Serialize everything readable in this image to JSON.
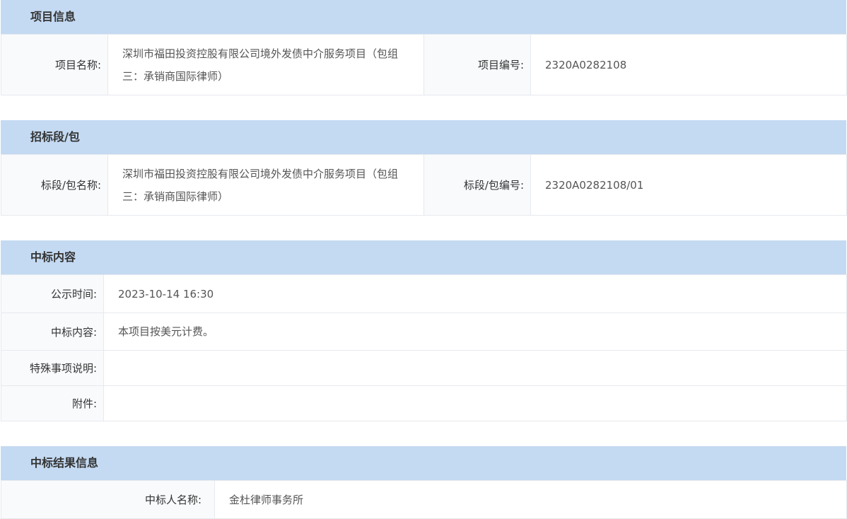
{
  "project_info": {
    "header": "项目信息",
    "name_label": "项目名称:",
    "name_value": "深圳市福田投资控股有限公司境外发债中介服务项目（包组三：承销商国际律师）",
    "code_label": "项目编号:",
    "code_value": "2320A0282108"
  },
  "bid_section": {
    "header": "招标段/包",
    "name_label": "标段/包名称:",
    "name_value": "深圳市福田投资控股有限公司境外发债中介服务项目（包组三：承销商国际律师）",
    "code_label": "标段/包编号:",
    "code_value": "2320A0282108/01"
  },
  "award_content": {
    "header": "中标内容",
    "rows": [
      {
        "label": "公示时间:",
        "value": "2023-10-14 16:30"
      },
      {
        "label": "中标内容:",
        "value": "本项目按美元计费。"
      },
      {
        "label": "特殊事项说明:",
        "value": ""
      },
      {
        "label": "附件:",
        "value": ""
      }
    ]
  },
  "award_result": {
    "header": "中标结果信息",
    "winner_label": "中标人名称:",
    "winner_value": "金杜律师事务所"
  }
}
